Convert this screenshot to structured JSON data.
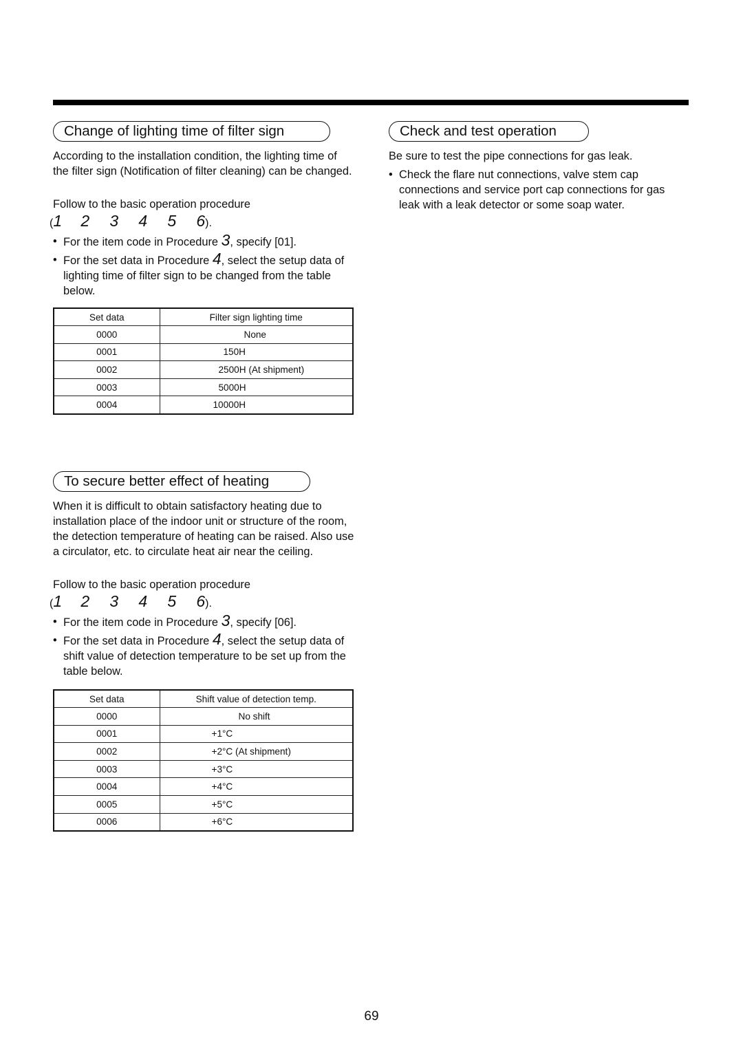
{
  "page": {
    "number": "69"
  },
  "filter_section": {
    "title": "Change of lighting time of filter sign",
    "intro": "According to the installation condition, the lighting time of the filter sign (Notification of filter cleaning) can be changed.",
    "procedure_text": "Follow to the basic operation procedure",
    "steps": [
      "1",
      "2",
      "3",
      "4",
      "5",
      "6"
    ],
    "steps_open": "(",
    "steps_close": ").",
    "bullets": [
      {
        "before": "For the item code in Procedure ",
        "proc": "3",
        "after": ", specify [01]."
      },
      {
        "before": "For the set data in Procedure ",
        "proc": "4",
        "after": ", select the setup data of lighting time of filter sign to be changed from the table below."
      }
    ],
    "table": {
      "headers": [
        "Set data",
        "Filter sign lighting time"
      ],
      "rows": [
        [
          "0000",
          "None"
        ],
        [
          "0001",
          "150H"
        ],
        [
          "0002",
          "2500H (At shipment)"
        ],
        [
          "0003",
          "5000H"
        ],
        [
          "0004",
          "10000H"
        ]
      ]
    }
  },
  "check_section": {
    "title": "Check and test operation",
    "intro": "Be sure to test the pipe connections for gas leak.",
    "bullets": [
      "Check the flare nut connections, valve stem cap connections and service port cap connections for gas leak with a leak detector or some soap water."
    ]
  },
  "heating_section": {
    "title": "To secure better effect of heating",
    "intro": "When it is difficult to obtain satisfactory heating due to installation place of the indoor unit or structure of the room, the detection temperature of heating can be raised. Also use a circulator, etc. to circulate heat air near the ceiling.",
    "procedure_text": "Follow to the basic operation procedure",
    "steps": [
      "1",
      "2",
      "3",
      "4",
      "5",
      "6"
    ],
    "steps_open": "(",
    "steps_close": ").",
    "bullets": [
      {
        "before": "For the item code in Procedure ",
        "proc": "3",
        "after": ", specify [06]."
      },
      {
        "before": "For the set data in Procedure ",
        "proc": "4",
        "after": ", select the setup data of shift value of detection temperature to be set up from the table below."
      }
    ],
    "table": {
      "headers": [
        "Set data",
        "Shift value of detection temp."
      ],
      "rows": [
        [
          "0000",
          "No shift"
        ],
        [
          "0001",
          "+1°C"
        ],
        [
          "0002",
          "+2°C (At shipment)"
        ],
        [
          "0003",
          "+3°C"
        ],
        [
          "0004",
          "+4°C"
        ],
        [
          "0005",
          "+5°C"
        ],
        [
          "0006",
          "+6°C"
        ]
      ]
    }
  },
  "bullet_glyph": "•"
}
